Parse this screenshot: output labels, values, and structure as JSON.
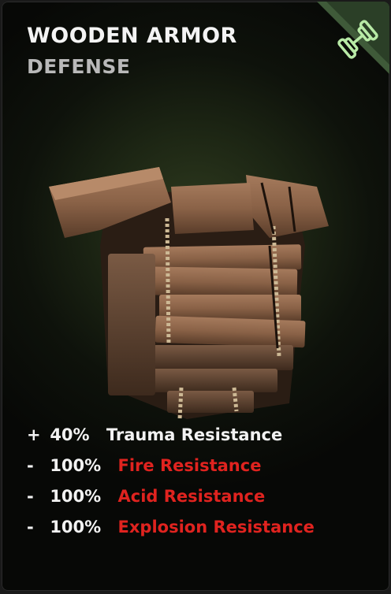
{
  "item": {
    "title": "WOODEN ARMOR",
    "category": "DEFENSE",
    "corner_icon": "dumbbell-icon",
    "accent_color": "#b8eaa6",
    "image": "wooden-armor-illustration"
  },
  "stats": [
    {
      "sign": "+",
      "value": "40%",
      "name": "Trauma Resistance",
      "color": "#f2f2f2"
    },
    {
      "sign": "-",
      "value": "100%",
      "name": "Fire Resistance",
      "color": "#e0231f"
    },
    {
      "sign": "-",
      "value": "100%",
      "name": "Acid Resistance",
      "color": "#e0231f"
    },
    {
      "sign": "-",
      "value": "100%",
      "name": "Explosion Resistance",
      "color": "#e0231f"
    }
  ]
}
